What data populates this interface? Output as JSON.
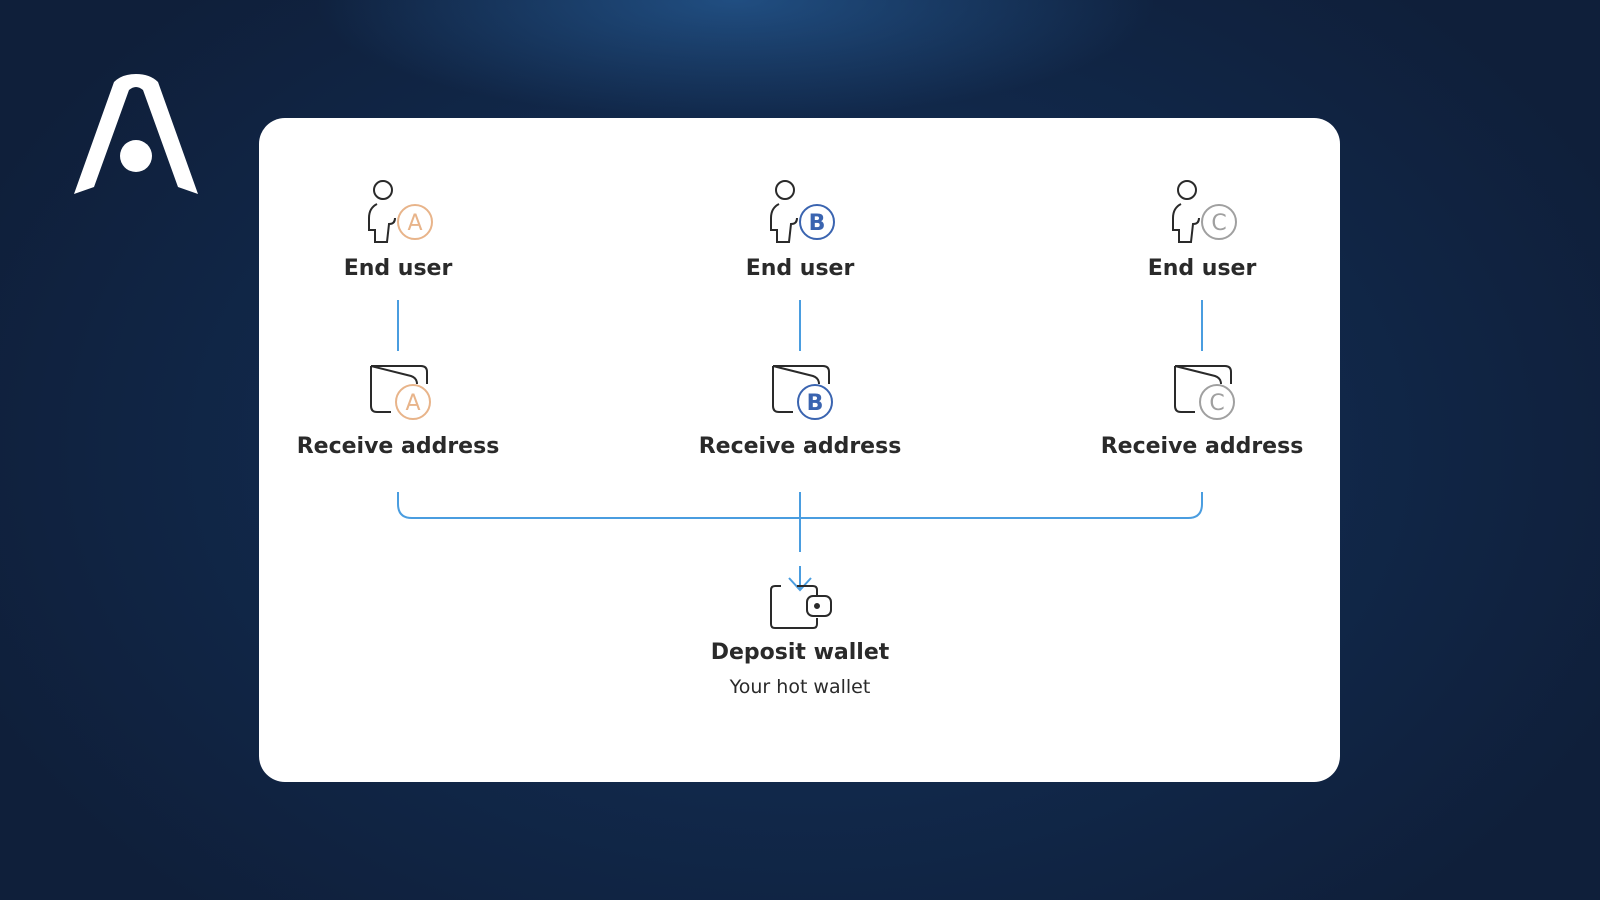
{
  "brand": {
    "logo_icon": "brand-a-logo-icon",
    "logo_color": "#ffffff"
  },
  "colors": {
    "background": "#11284a",
    "card": "#ffffff",
    "connector": "#4a9de0",
    "badge_a": "#e8b48a",
    "badge_b": "#3a64b0",
    "badge_c": "#a0a0a0",
    "icon_stroke": "#2a2a2a"
  },
  "diagram": {
    "columns": [
      {
        "user_label": "End user",
        "user_badge": "A",
        "user_icon": "person-icon",
        "address_label": "Receive address",
        "address_badge": "A",
        "address_icon": "wallet-card-icon"
      },
      {
        "user_label": "End user",
        "user_badge": "B",
        "user_icon": "person-icon",
        "address_label": "Receive address",
        "address_badge": "B",
        "address_icon": "wallet-card-icon"
      },
      {
        "user_label": "End user",
        "user_badge": "C",
        "user_icon": "person-icon",
        "address_label": "Receive address",
        "address_badge": "C",
        "address_icon": "wallet-card-icon"
      }
    ],
    "destination": {
      "label": "Deposit wallet",
      "sublabel": "Your hot wallet",
      "icon": "wallet-icon"
    }
  }
}
